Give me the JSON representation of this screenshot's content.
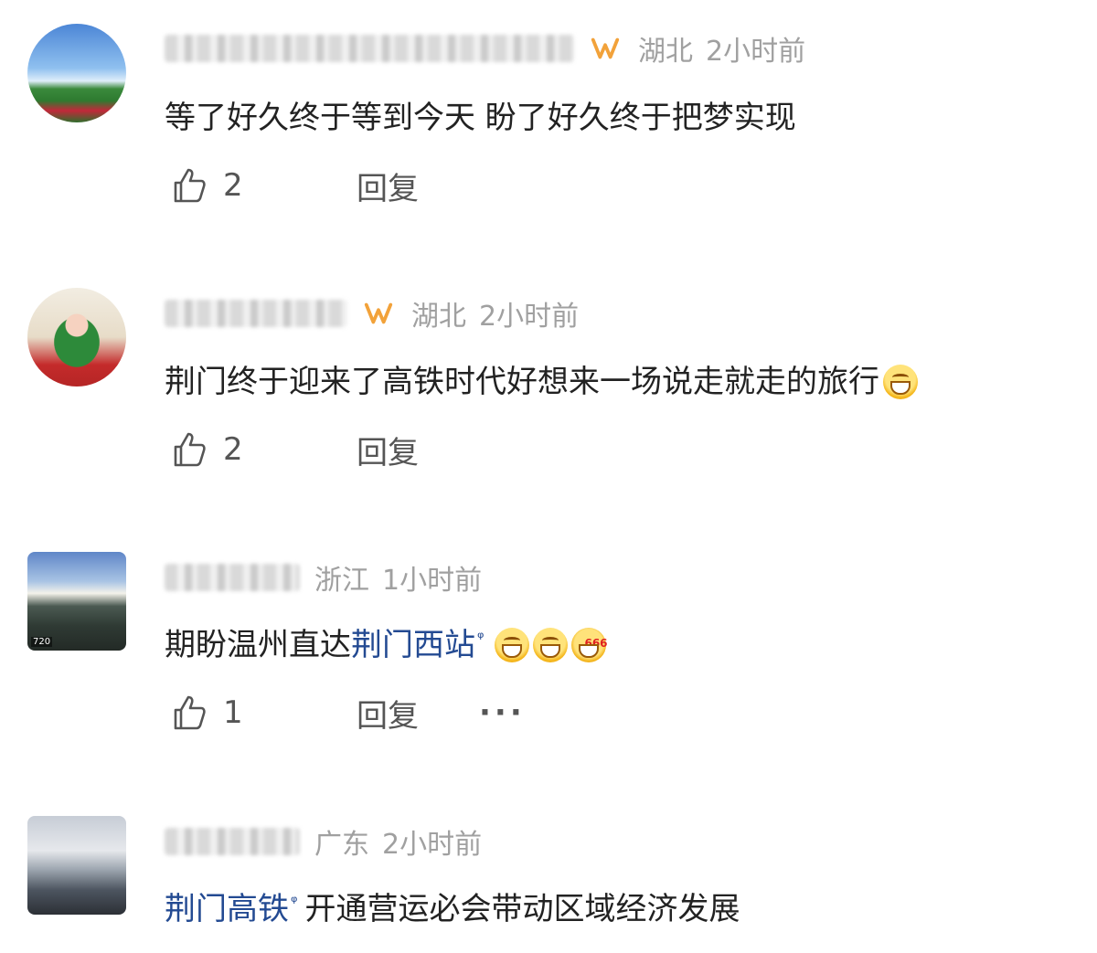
{
  "comments": [
    {
      "location": "湖北",
      "time": "2小时前",
      "text": "等了好久终于等到今天 盼了好久终于把梦实现",
      "likes": "2",
      "reply_label": "回复"
    },
    {
      "location": "湖北",
      "time": "2小时前",
      "text": "荆门终于迎来了高铁时代好想来一场说走就走的旅行",
      "likes": "2",
      "reply_label": "回复"
    },
    {
      "location": "浙江",
      "time": "1小时前",
      "text_prefix": "期盼温州直达",
      "topic": "荆门西站",
      "likes": "1",
      "reply_label": "回复",
      "more_label": "···"
    },
    {
      "location": "广东",
      "time": "2小时前",
      "topic": "荆门高铁",
      "text_suffix": "开通营运必会带动区域经济发展"
    }
  ],
  "search_glyph": "ᵠ",
  "avatar3_tag": "720",
  "colors": {
    "topic_link": "#234a92",
    "vip_badge": "#f2a23a",
    "meta_gray": "#a0a0a0"
  },
  "icons": [
    "thumbs-up-icon",
    "vip-badge-icon",
    "grin-emoji-icon",
    "666-emoji-icon",
    "topic-search-icon"
  ]
}
